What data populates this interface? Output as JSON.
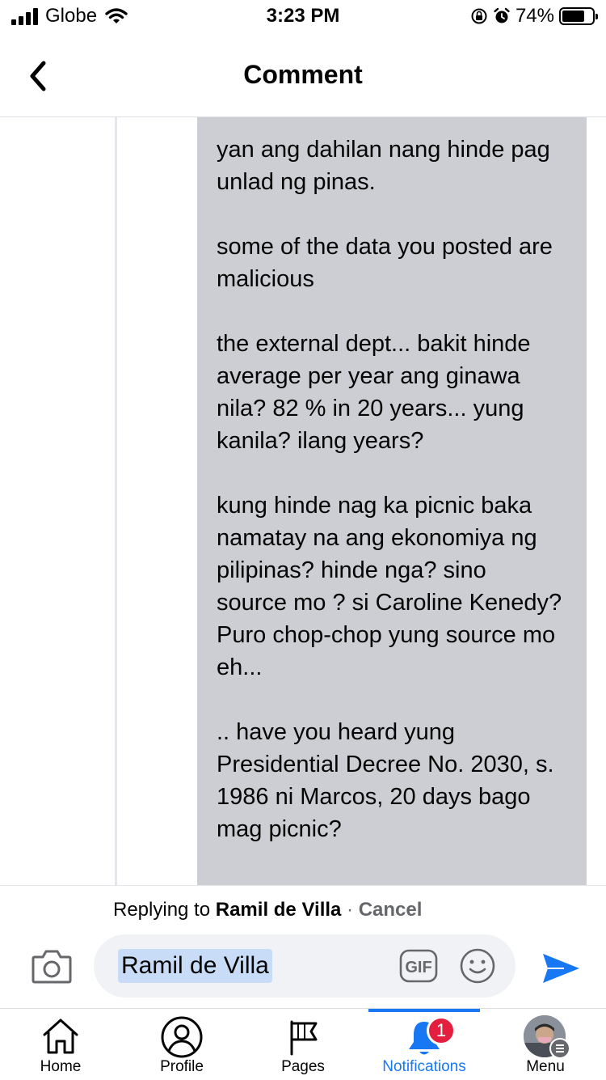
{
  "status_bar": {
    "carrier": "Globe",
    "time": "3:23 PM",
    "battery_percent": "74%",
    "battery_level": 0.74,
    "icons": [
      "signal-icon",
      "wifi-icon",
      "orientation-lock-icon",
      "alarm-icon",
      "battery-icon"
    ]
  },
  "header": {
    "title": "Comment",
    "back_icon": "chevron-left-icon"
  },
  "comment": {
    "text": "yan ang dahilan nang hinde pag unlad ng pinas.\n\nsome of the data you posted are malicious\n\nthe external dept... bakit hinde average per year ang ginawa nila? 82 % in 20 years... yung kanila? ilang years?\n\nkung hinde nag ka picnic baka namatay na ang ekonomiya ng pilipinas? hinde nga? sino  source mo ? si Caroline Kenedy? Puro chop-chop yung source mo eh...\n\n.. have you heard yung Presidential Decree No. 2030, s. 1986 ni Marcos, 20 days bago mag picnic?",
    "bubble_color": "#ccced3"
  },
  "reply": {
    "prefix": "Replying to",
    "name": "Ramil de Villa",
    "separator": "·",
    "cancel_label": "Cancel",
    "input_value": "Ramil de Villa",
    "gif_label": "GIF",
    "send_color": "#1877f2"
  },
  "tabs": [
    {
      "label": "Home",
      "icon": "home-icon"
    },
    {
      "label": "Profile",
      "icon": "profile-icon"
    },
    {
      "label": "Pages",
      "icon": "flag-icon"
    },
    {
      "label": "Notifications",
      "icon": "bell-icon",
      "active": true,
      "badge": "1"
    },
    {
      "label": "Menu",
      "icon": "avatar-menu-icon"
    }
  ],
  "colors": {
    "accent": "#1877f2",
    "badge": "#e41e3f",
    "text": "#050505",
    "muted": "#65676b"
  }
}
